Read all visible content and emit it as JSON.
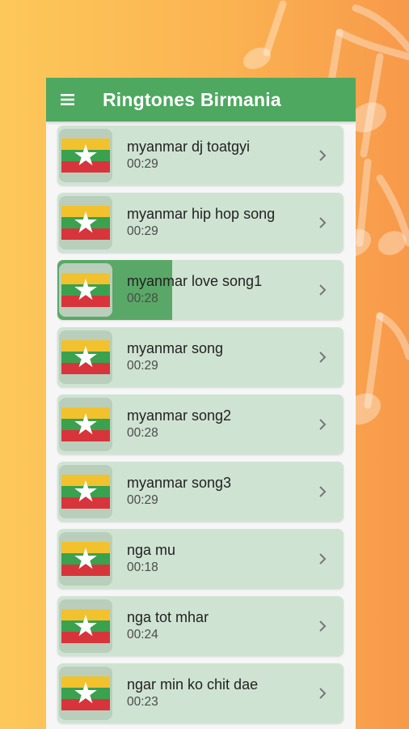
{
  "app": {
    "title": "Ringtones Birmania"
  },
  "songs": [
    {
      "name": "myanmar dj toatgyi",
      "duration": "00:29",
      "progress": 0
    },
    {
      "name": "myanmar hip hop song",
      "duration": "00:29",
      "progress": 0
    },
    {
      "name": "myanmar love song1",
      "duration": "00:28",
      "progress": 0.4
    },
    {
      "name": "myanmar song",
      "duration": "00:29",
      "progress": 0
    },
    {
      "name": "myanmar song2",
      "duration": "00:28",
      "progress": 0
    },
    {
      "name": "myanmar song3",
      "duration": "00:29",
      "progress": 0
    },
    {
      "name": "nga mu",
      "duration": "00:18",
      "progress": 0
    },
    {
      "name": "nga tot mhar",
      "duration": "00:24",
      "progress": 0
    },
    {
      "name": "ngar min ko chit dae",
      "duration": "00:23",
      "progress": 0
    }
  ],
  "icons": {
    "menu": "hamburger-icon",
    "thumbnail": "myanmar-flag-icon",
    "row_action": "chevron-right-icon"
  },
  "colors": {
    "appbar": "#4ea860",
    "row_bg": "#cfe3d2",
    "playing_fill": "#5aa867",
    "flag_yellow": "#f2c12e",
    "flag_green": "#3aa14f",
    "flag_red": "#d8343b"
  }
}
